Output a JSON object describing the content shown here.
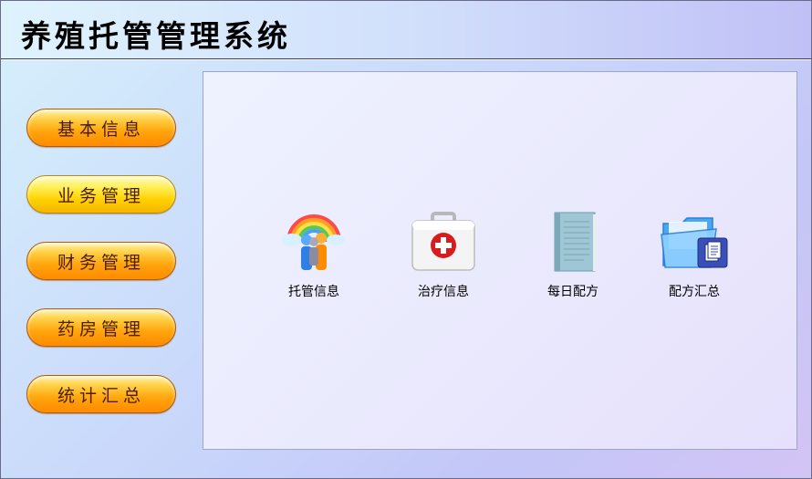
{
  "app": {
    "title": "养殖托管管理系统"
  },
  "sidebar": {
    "items": [
      {
        "label": "基本信息"
      },
      {
        "label": "业务管理"
      },
      {
        "label": "财务管理"
      },
      {
        "label": "药房管理"
      },
      {
        "label": "统计汇总"
      }
    ],
    "active_index": 1
  },
  "main": {
    "tiles": [
      {
        "label": "托管信息",
        "icon": "people-rainbow-icon"
      },
      {
        "label": "治疗信息",
        "icon": "first-aid-kit-icon"
      },
      {
        "label": "每日配方",
        "icon": "notebook-icon"
      },
      {
        "label": "配方汇总",
        "icon": "folder-document-icon"
      }
    ]
  },
  "colors": {
    "nav_orange": "#ff9c00",
    "nav_active_yellow": "#ffe000",
    "medical_red": "#d81c1c",
    "folder_blue": "#2a7fd8"
  }
}
